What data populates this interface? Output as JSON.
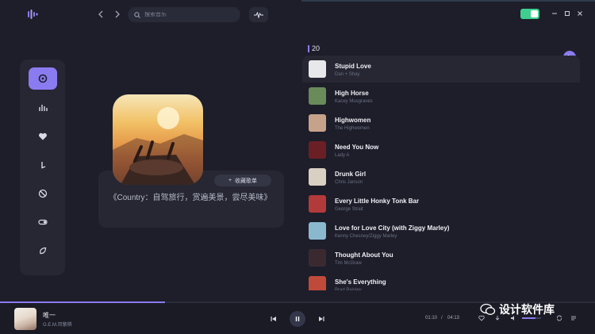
{
  "search": {
    "placeholder": "搜索音乐"
  },
  "playlist": {
    "cover_alt": "Country playlist cover",
    "favorite_label": "收藏歌单",
    "description": "《Country：自驾旅行，赏遍美景，尝尽美味》"
  },
  "songs_header": {
    "count": "20"
  },
  "songs": [
    {
      "title": "Stupid Love",
      "artist": "Dan + Shay",
      "thumb_color": "#e8e8ea"
    },
    {
      "title": "High Horse",
      "artist": "Kacey Musgraves",
      "thumb_color": "#6b8a5a"
    },
    {
      "title": "Highwomen",
      "artist": "The Highwomen",
      "thumb_color": "#c7a28a"
    },
    {
      "title": "Need You Now",
      "artist": "Lady A",
      "thumb_color": "#6a1f24"
    },
    {
      "title": "Drunk Girl",
      "artist": "Chris Janson",
      "thumb_color": "#d8d0c2"
    },
    {
      "title": "Every Little Honky Tonk Bar",
      "artist": "George Strait",
      "thumb_color": "#b23a3a"
    },
    {
      "title": "Love for Love City (with Ziggy Marley)",
      "artist": "Kenny Chesney/Ziggy Marley",
      "thumb_color": "#8ab8cf"
    },
    {
      "title": "Thought About You",
      "artist": "Tim McGraw",
      "thumb_color": "#3a2a30"
    },
    {
      "title": "She's Everything",
      "artist": "Brad Paisley",
      "thumb_color": "#c04a3a"
    }
  ],
  "now_playing": {
    "title": "唯一",
    "artist": "G.E.M.邓紫棋",
    "current_time": "01:10",
    "separator": "/",
    "total_time": "04:13",
    "progress": 0.277,
    "volume": 0.7
  },
  "watermark": {
    "text": "设计软件库"
  },
  "colors": {
    "accent": "#8b7bf0",
    "toggle": "#3ecf8e",
    "background": "#1d1e2a"
  }
}
